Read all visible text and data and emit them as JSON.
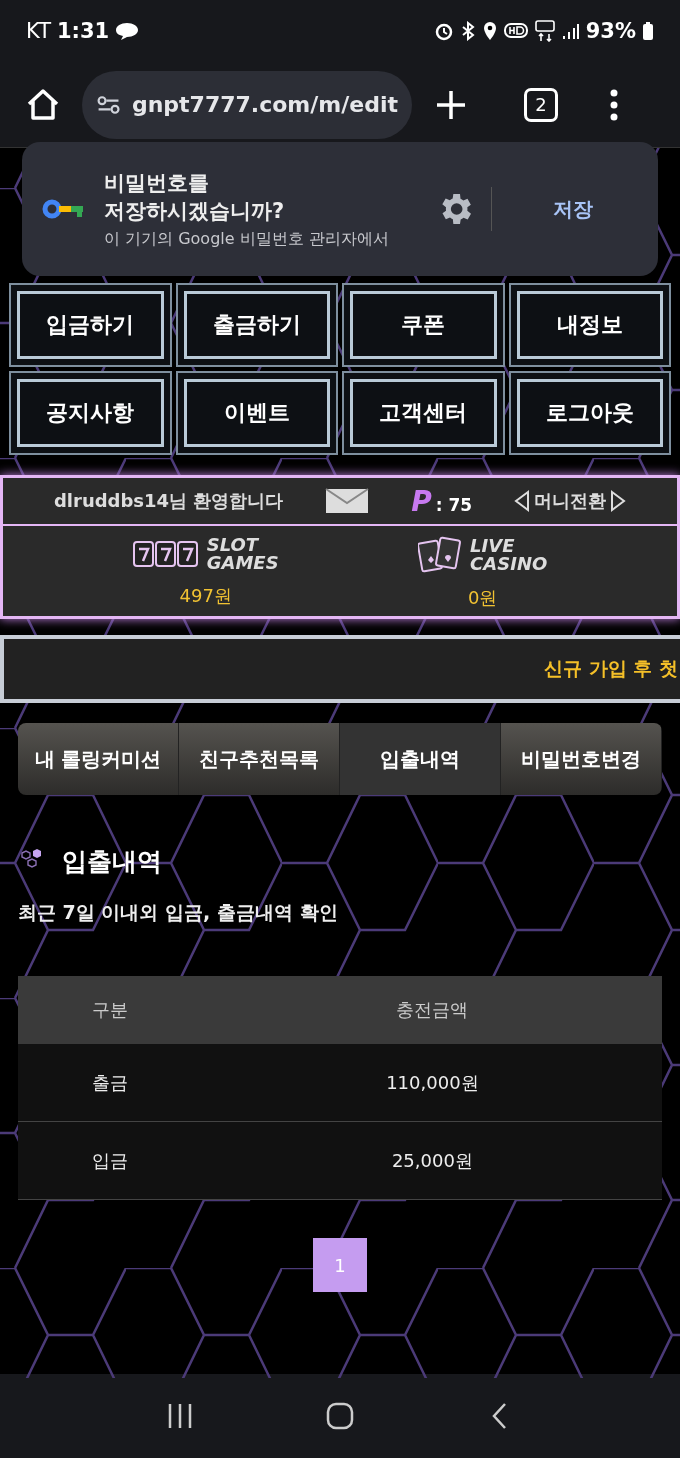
{
  "status_bar": {
    "carrier": "KT",
    "time": "1:31",
    "battery": "93%"
  },
  "browser": {
    "url": "gnpt7777.com/m/edit",
    "tab_count": "2"
  },
  "password_prompt": {
    "title_lines": [
      "비밀번호를",
      "저장하시겠습니까?"
    ],
    "subtitle": "이 기기의 Google 비밀번호 관리자에서",
    "save_button": "저장"
  },
  "nav_buttons": [
    "입금하기",
    "출금하기",
    "쿠폰",
    "내정보",
    "공지사항",
    "이벤트",
    "고객센터",
    "로그아웃"
  ],
  "account": {
    "welcome": "dlruddbs14님 환영합니다",
    "points_label": "P",
    "points": ": 75",
    "money_exchange": "머니전환",
    "wallets": [
      {
        "kind": "slot",
        "line1": "SLOT",
        "line2": "GAMES",
        "amount": "497원"
      },
      {
        "kind": "casino",
        "line1": "LIVE",
        "line2": "CASINO",
        "amount": "0원"
      }
    ]
  },
  "notice": "신규 가입 후 첫",
  "tabs": [
    {
      "label": "내 롤링커미션",
      "selected": false
    },
    {
      "label": "친구추천목록",
      "selected": false
    },
    {
      "label": "입출내역",
      "selected": true
    },
    {
      "label": "비밀번호변경",
      "selected": false
    }
  ],
  "section": {
    "title": "입출내역",
    "description": "최근 7일 이내외 입금, 출금내역 확인"
  },
  "table": {
    "columns": [
      "구분",
      "충전금액"
    ],
    "rows": [
      [
        "출금",
        "110,000원"
      ],
      [
        "입금",
        "25,000원"
      ]
    ]
  },
  "pagination": [
    {
      "label": "1",
      "selected": true
    }
  ]
}
